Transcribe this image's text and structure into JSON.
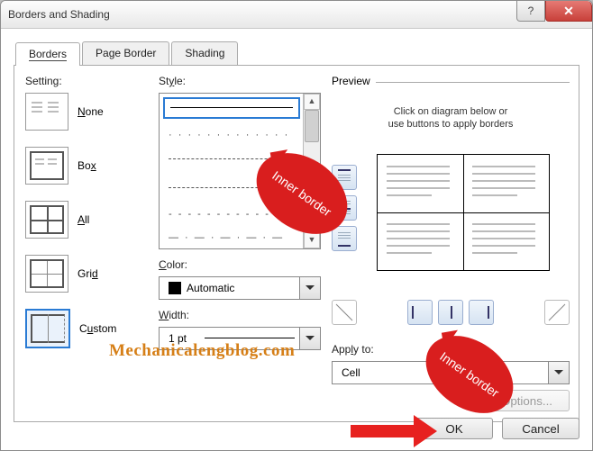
{
  "title": "Borders and Shading",
  "tabs": {
    "borders": "Borders",
    "page_border": "Page Border",
    "shading": "Shading"
  },
  "setting_label": "Setting:",
  "settings": {
    "none": "None",
    "box": "Box",
    "all": "All",
    "grid": "Grid",
    "custom": "Custom"
  },
  "style_label": "Style:",
  "color_label": "Color:",
  "color_value": "Automatic",
  "width_label": "Width:",
  "width_value": "1 pt",
  "preview_label": "Preview",
  "preview_hint_1": "Click on diagram below or",
  "preview_hint_2": "use buttons to apply borders",
  "apply_label": "Apply to:",
  "apply_value": "Cell",
  "options_label": "Options...",
  "ok_label": "OK",
  "cancel_label": "Cancel",
  "callout1": "Inner border",
  "callout2": "Inner border",
  "watermark": "Mechanicalengblog.com"
}
